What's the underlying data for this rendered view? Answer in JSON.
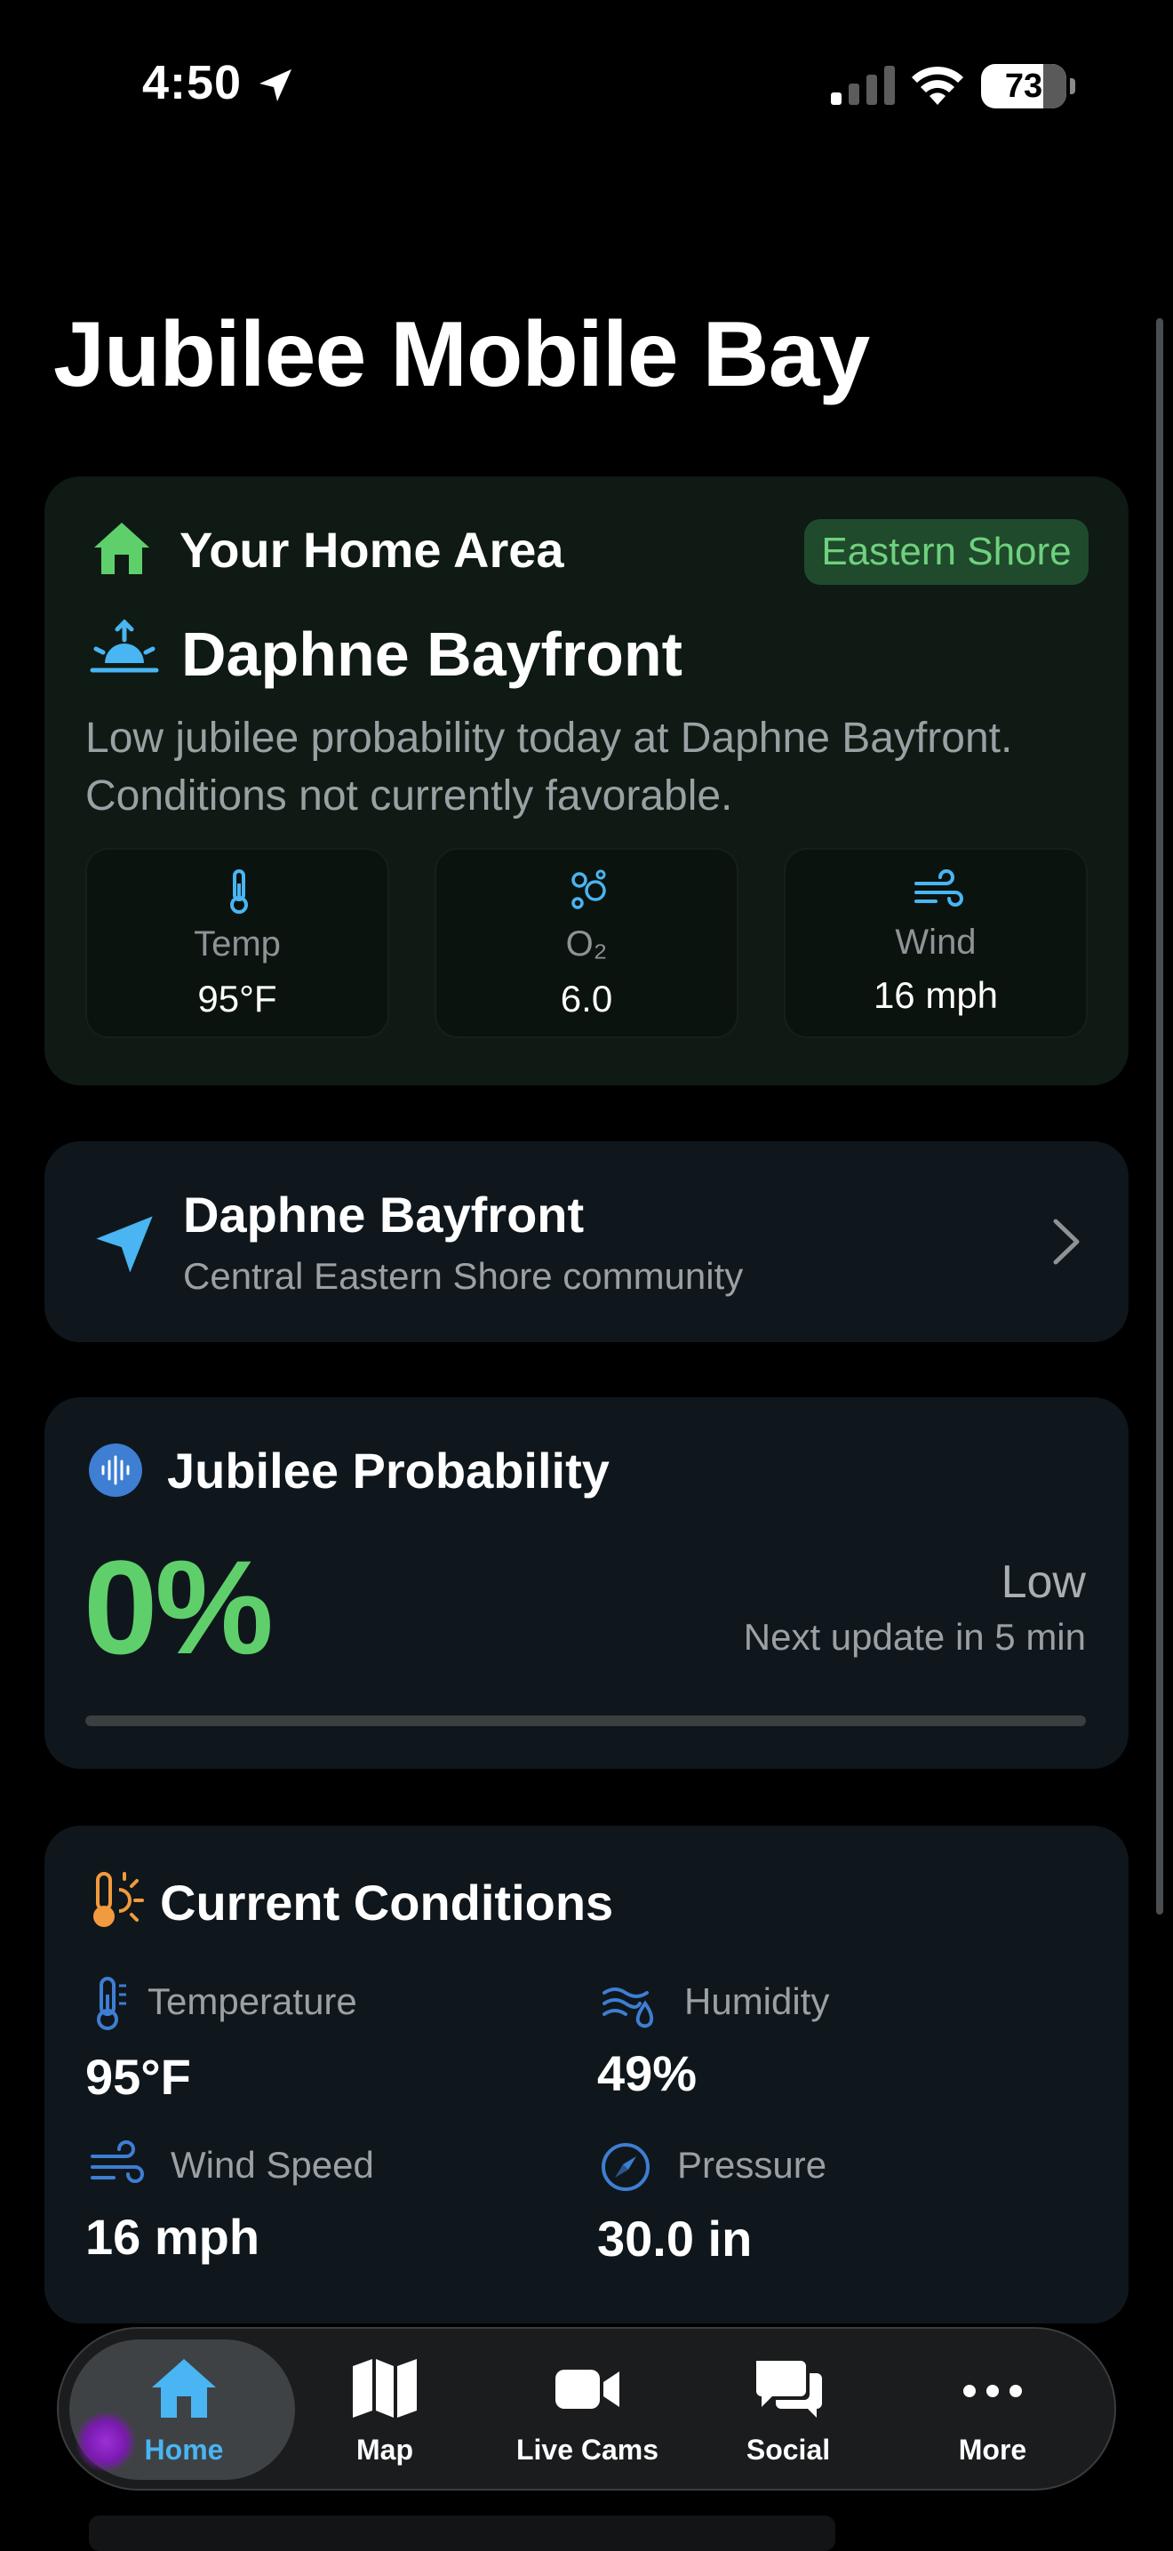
{
  "status_bar": {
    "time": "4:50",
    "battery": "73"
  },
  "page_title": "Jubilee Mobile Bay",
  "home_area": {
    "title": "Your Home Area",
    "region_badge": "Eastern Shore",
    "location_name": "Daphne Bayfront",
    "description": "Low jubilee probability today at Daphne Bayfront. Conditions not currently favorable.",
    "stats": [
      {
        "label": "Temp",
        "value": "95°F",
        "icon": "thermometer-icon"
      },
      {
        "label": "O₂",
        "value": "6.0",
        "icon": "oxygen-bubbles-icon"
      },
      {
        "label": "Wind",
        "value": "16 mph",
        "icon": "wind-icon"
      }
    ]
  },
  "location_card": {
    "name": "Daphne Bayfront",
    "subtitle": "Central Eastern Shore community"
  },
  "probability": {
    "title": "Jubilee Probability",
    "value": "0%",
    "value_fraction": 0,
    "level": "Low",
    "next_update": "Next update in 5 min"
  },
  "conditions": {
    "title": "Current Conditions",
    "items": [
      {
        "label": "Temperature",
        "value": "95°F",
        "icon": "thermometer-icon"
      },
      {
        "label": "Humidity",
        "value": "49%",
        "icon": "humidity-icon"
      },
      {
        "label": "Wind Speed",
        "value": "16 mph",
        "icon": "wind-icon"
      },
      {
        "label": "Pressure",
        "value": "30.0 in",
        "icon": "gauge-icon"
      }
    ]
  },
  "tabs": [
    {
      "label": "Home",
      "icon": "house-icon",
      "active": true
    },
    {
      "label": "Map",
      "icon": "map-icon",
      "active": false
    },
    {
      "label": "Live Cams",
      "icon": "video-camera-icon",
      "active": false
    },
    {
      "label": "Social",
      "icon": "chat-bubbles-icon",
      "active": false
    },
    {
      "label": "More",
      "icon": "ellipsis-icon",
      "active": false
    }
  ],
  "colors": {
    "accent_blue": "#49b5f2",
    "accent_green": "#5fcf6b",
    "badge_bg": "#1f4a2b",
    "orange": "#f19a3e"
  }
}
